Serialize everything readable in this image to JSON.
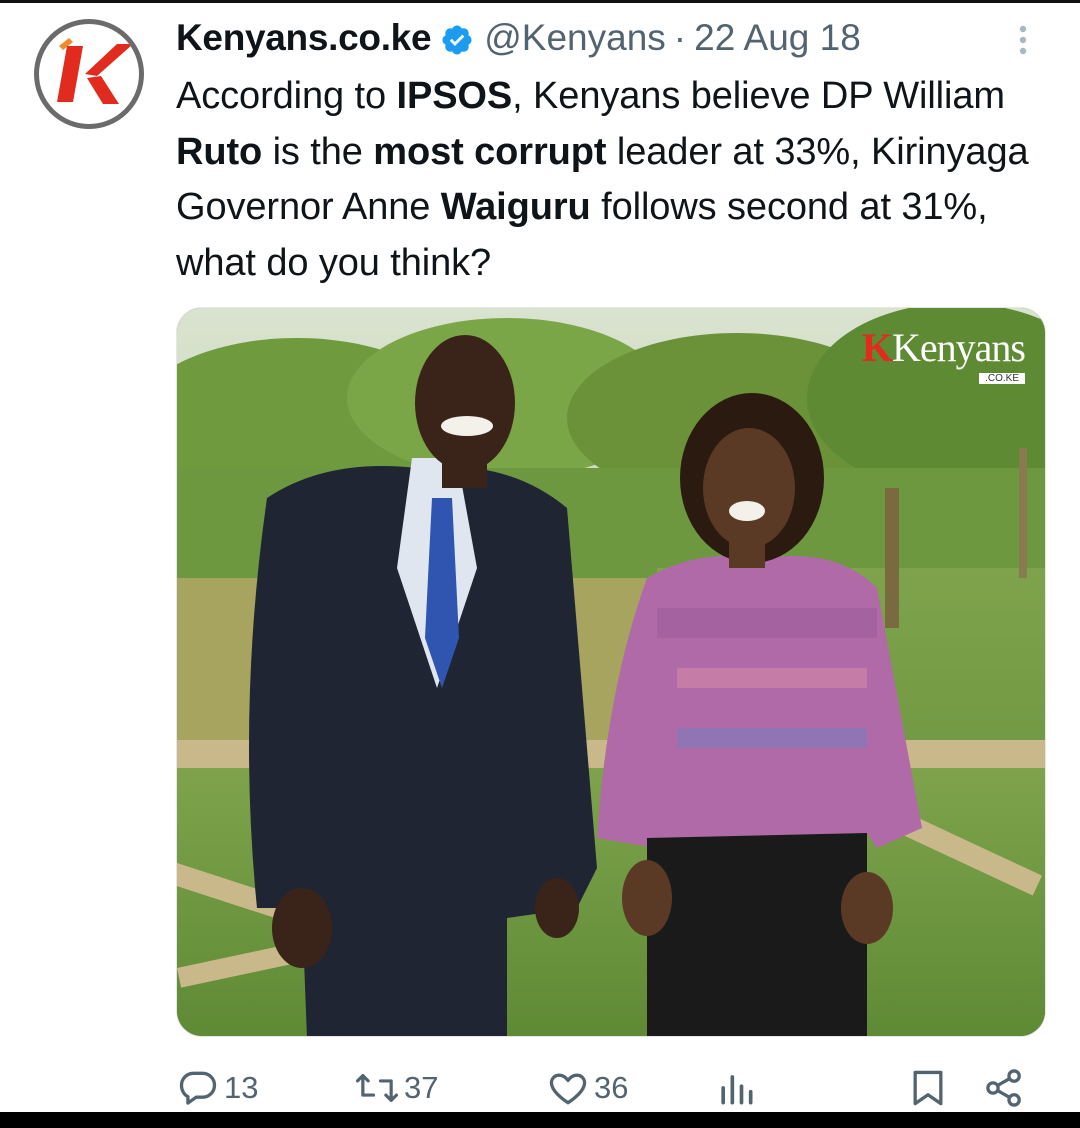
{
  "author": {
    "display_name": "Kenyans.co.ke",
    "handle": "@Kenyans",
    "separator": "·",
    "date": "22 Aug 18",
    "avatar_icon": "kenyans-k-logo",
    "verified_icon": "verified-badge-icon"
  },
  "tweet": {
    "segments": [
      {
        "text": "According to ",
        "bold": false
      },
      {
        "text": "IPSOS",
        "bold": true
      },
      {
        "text": ", Kenyans believe DP William ",
        "bold": false
      },
      {
        "text": "Ruto",
        "bold": true
      },
      {
        "text": " is the ",
        "bold": false
      },
      {
        "text": "most corrupt",
        "bold": true
      },
      {
        "text": " leader at 33%, Kirinyaga Governor Anne ",
        "bold": false
      },
      {
        "text": "Waiguru",
        "bold": true
      },
      {
        "text": " follows second at 31%, what do you think?",
        "bold": false
      }
    ]
  },
  "media": {
    "watermark_brand": "Kenyans",
    "watermark_k": "K",
    "watermark_sub": ".CO.KE"
  },
  "actions": {
    "replies": "13",
    "reposts": "37",
    "likes": "36"
  },
  "colors": {
    "text": "#0f1419",
    "secondary": "#536471",
    "verified": "#1d9bf0",
    "brand_red": "#e22b1f"
  }
}
